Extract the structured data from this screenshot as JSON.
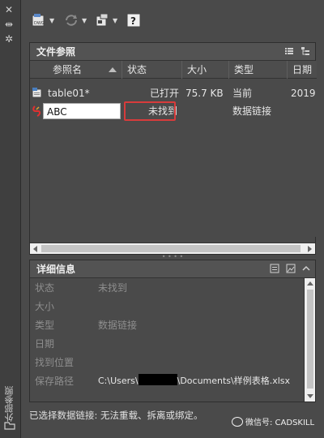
{
  "sidebar": {
    "title": "外部参照"
  },
  "file_refs": {
    "title": "文件参照",
    "columns": [
      "参照名",
      "状态",
      "大小",
      "类型",
      "日期"
    ],
    "rows": [
      {
        "name": "table01*",
        "status": "已打开",
        "size": "75.7 KB",
        "type": "当前",
        "date": "2019"
      },
      {
        "name": "ABC",
        "status": "未找到",
        "size": "",
        "type": "数据链接",
        "date": ""
      }
    ]
  },
  "details": {
    "title": "详细信息",
    "rows": [
      {
        "label": "状态",
        "value": "未找到"
      },
      {
        "label": "大小",
        "value": ""
      },
      {
        "label": "类型",
        "value": "数据链接"
      },
      {
        "label": "日期",
        "value": ""
      },
      {
        "label": "找到位置",
        "value": ""
      },
      {
        "label": "保存路径",
        "value_prefix": "C:\\Users\\",
        "value_suffix": "\\Documents\\样例表格.xlsx"
      }
    ]
  },
  "status_message": "已选择数据链接: 无法重载、拆离或绑定。",
  "watermark": "微信号: CADSKILL",
  "colors": {
    "background": "#4a4a4a",
    "highlight_box": "#d83b3b",
    "edit_field": "#ffffff"
  }
}
